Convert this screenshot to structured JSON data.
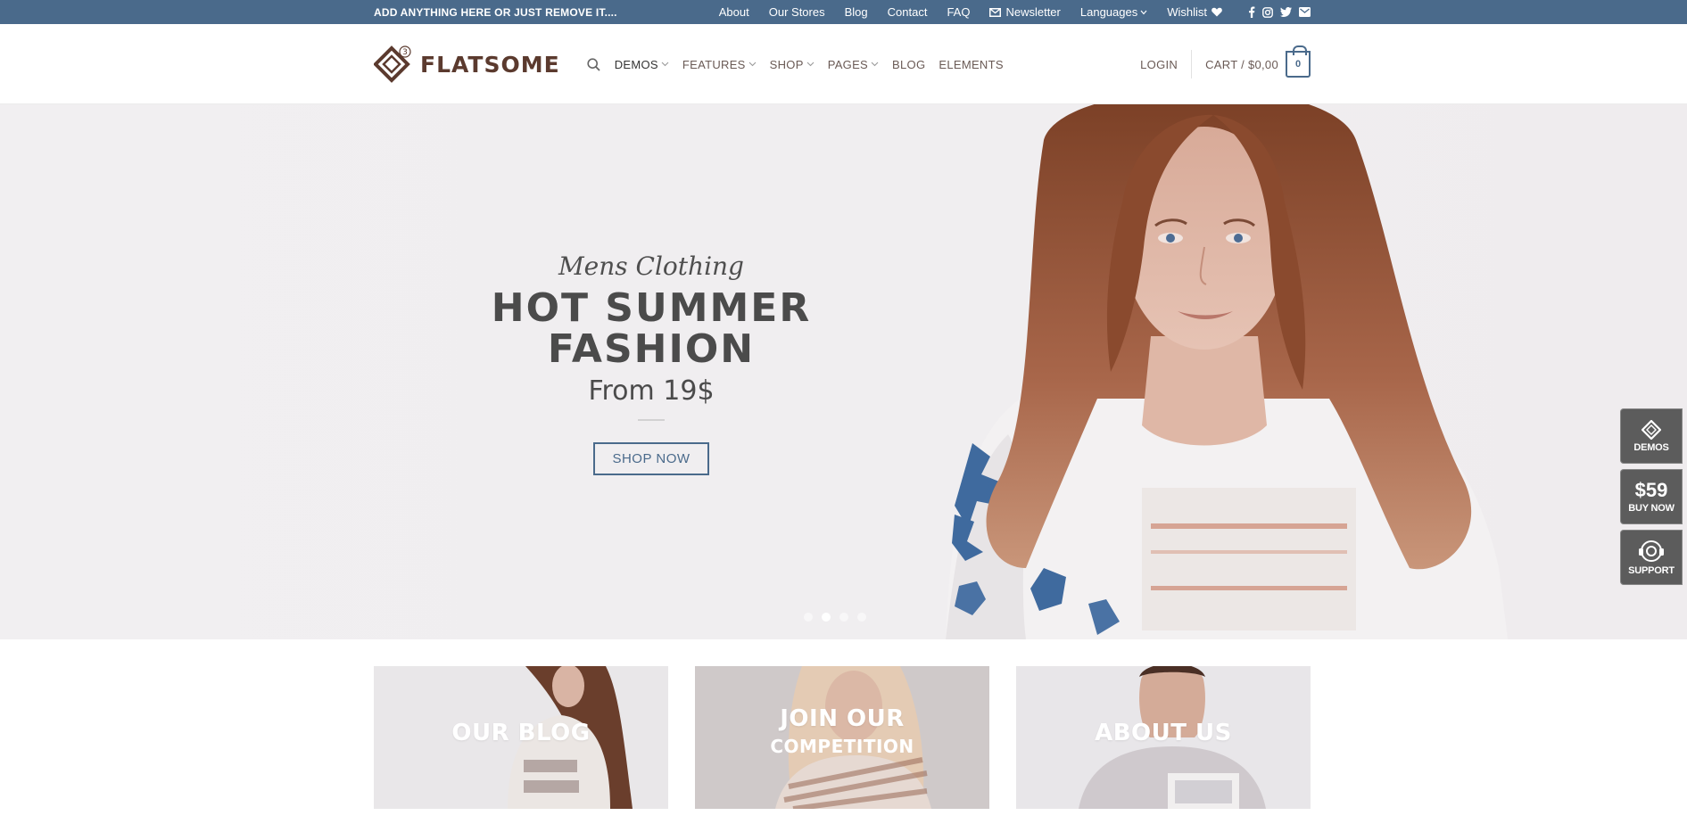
{
  "topbar": {
    "promo": "ADD ANYTHING HERE OR JUST REMOVE IT....",
    "links": [
      {
        "label": "About"
      },
      {
        "label": "Our Stores"
      },
      {
        "label": "Blog"
      },
      {
        "label": "Contact"
      },
      {
        "label": "FAQ"
      },
      {
        "label": "Newsletter",
        "icon": "mail-icon"
      },
      {
        "label": "Languages",
        "icon": "chevron-down-icon"
      },
      {
        "label": "Wishlist",
        "icon": "heart-icon"
      }
    ],
    "social_icons": [
      "facebook-icon",
      "instagram-icon",
      "twitter-icon",
      "email-icon"
    ],
    "background": "#4a6a8b"
  },
  "header": {
    "logo_text": "FLATSOME",
    "logo_badge": "3",
    "nav": [
      {
        "label": "DEMOS",
        "dropdown": true,
        "active": true
      },
      {
        "label": "FEATURES",
        "dropdown": true
      },
      {
        "label": "SHOP",
        "dropdown": true
      },
      {
        "label": "PAGES",
        "dropdown": true
      },
      {
        "label": "BLOG",
        "dropdown": false
      },
      {
        "label": "ELEMENTS",
        "dropdown": false
      }
    ],
    "login": "LOGIN",
    "cart_label": "CART / $0,00",
    "cart_count": "0"
  },
  "hero": {
    "script": "Mens Clothing",
    "title_line1": "HOT SUMMER",
    "title_line2": "FASHION",
    "price": "From 19$",
    "button": "SHOP NOW",
    "slides": 4,
    "active_slide": 2
  },
  "side_widget": {
    "demos": "DEMOS",
    "price": "$59",
    "buy": "BUY NOW",
    "support": "SUPPORT"
  },
  "features": [
    {
      "title": "OUR BLOG",
      "subtitle": ""
    },
    {
      "title": "JOIN OUR",
      "subtitle": "COMPETITION"
    },
    {
      "title": "ABOUT US",
      "subtitle": ""
    }
  ],
  "colors": {
    "accent": "#4a6a8b",
    "brand": "#5b3a2e"
  }
}
